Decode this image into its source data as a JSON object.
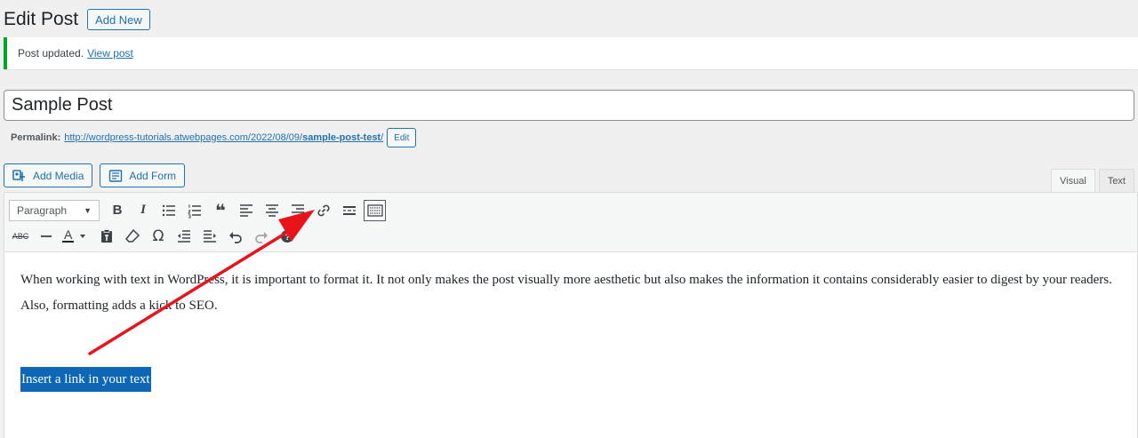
{
  "header": {
    "title": "Edit Post",
    "add_new_label": "Add New"
  },
  "notice": {
    "text": "Post updated.",
    "link_label": "View post"
  },
  "post": {
    "title_value": "Sample Post",
    "permalink_label": "Permalink:",
    "permalink_base": "http://wordpress-tutorials.atwebpages.com/2022/08/09/",
    "permalink_slug": "sample-post-test",
    "permalink_trailing": "/",
    "edit_label": "Edit"
  },
  "media": {
    "add_media_label": "Add Media",
    "add_form_label": "Add Form"
  },
  "tabs": {
    "visual_label": "Visual",
    "text_label": "Text"
  },
  "toolbar": {
    "format_value": "Paragraph",
    "row1_icons": [
      "bold-icon",
      "italic-icon",
      "bulleted-list-icon",
      "numbered-list-icon",
      "blockquote-icon",
      "align-left-icon",
      "align-center-icon",
      "align-right-icon",
      "link-icon",
      "read-more-icon",
      "toolbar-toggle-icon"
    ],
    "row2_icons": [
      "strikethrough-icon",
      "horizontal-line-icon",
      "text-color-icon",
      "paste-text-icon",
      "clear-formatting-icon",
      "special-character-icon",
      "outdent-icon",
      "indent-icon",
      "undo-icon",
      "redo-icon",
      "help-icon"
    ]
  },
  "content": {
    "paragraph": "When working with text in WordPress, it is important to format it. It not only makes the post visually more aesthetic but also makes the information it contains considerably easier to digest by your readers. Also, formatting adds a kick to SEO.",
    "selected_text": "Insert a link in your text"
  },
  "colors": {
    "accent": "#2271b1",
    "success": "#00a32a",
    "selection": "#0e67b6",
    "annotation_arrow": "#e8141b"
  }
}
